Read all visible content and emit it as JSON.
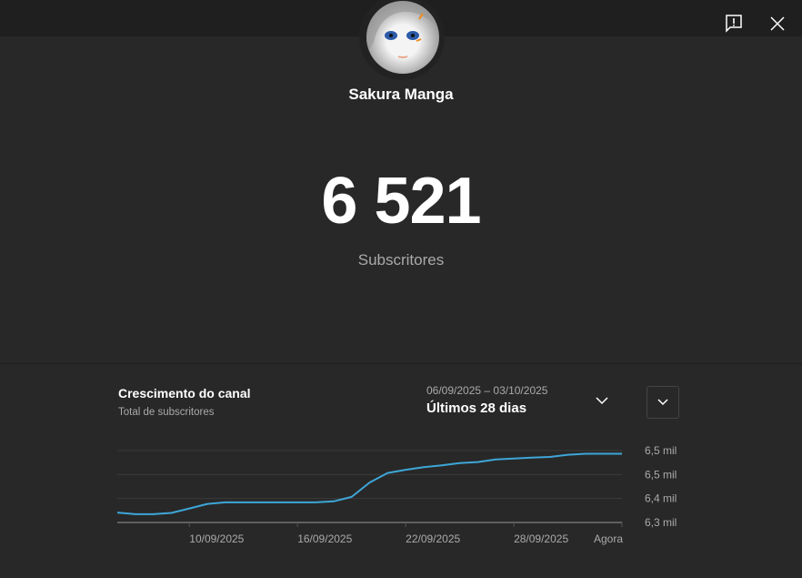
{
  "header": {
    "channel_name": "Sakura Manga",
    "feedback_icon": "feedback-icon",
    "close_icon": "close-icon"
  },
  "stats": {
    "subscriber_count": "6 521",
    "subscriber_label": "Subscritores"
  },
  "growth": {
    "title": "Crescimento do canal",
    "subtitle": "Total de subscritores",
    "date_range": "06/09/2025 – 03/10/2025",
    "period": "Últimos 28 dias"
  },
  "colors": {
    "line": "#3ea6d8",
    "grid": "#3a3a3a",
    "axis": "#888888"
  },
  "chart_data": {
    "type": "line",
    "title": "Crescimento do canal",
    "ylabel": "Total de subscritores",
    "x_days": [
      0,
      1,
      2,
      3,
      4,
      5,
      6,
      7,
      8,
      9,
      10,
      11,
      12,
      13,
      14,
      15,
      16,
      17,
      18,
      19,
      20,
      21,
      22,
      23,
      24,
      25,
      26,
      27,
      28
    ],
    "values": [
      6331,
      6326,
      6326,
      6330,
      6344,
      6358,
      6363,
      6363,
      6363,
      6363,
      6363,
      6363,
      6366,
      6380,
      6425,
      6455,
      6465,
      6473,
      6479,
      6486,
      6489,
      6497,
      6500,
      6503,
      6505,
      6512,
      6515,
      6515,
      6515
    ],
    "xlim": [
      0,
      28
    ],
    "ylim": [
      6300,
      6525
    ],
    "x_ticks": [
      {
        "day": 4,
        "label": "10/09/2025"
      },
      {
        "day": 10,
        "label": "16/09/2025"
      },
      {
        "day": 16,
        "label": "22/09/2025"
      },
      {
        "day": 22,
        "label": "28/09/2025"
      },
      {
        "day": 28,
        "label": "Agora"
      }
    ],
    "y_ticks": [
      {
        "value": 6525,
        "label": "6,5 mil"
      },
      {
        "value": 6450,
        "label": "6,5 mil"
      },
      {
        "value": 6375,
        "label": "6,4 mil"
      },
      {
        "value": 6300,
        "label": "6,3 mil"
      }
    ],
    "grid": true
  }
}
